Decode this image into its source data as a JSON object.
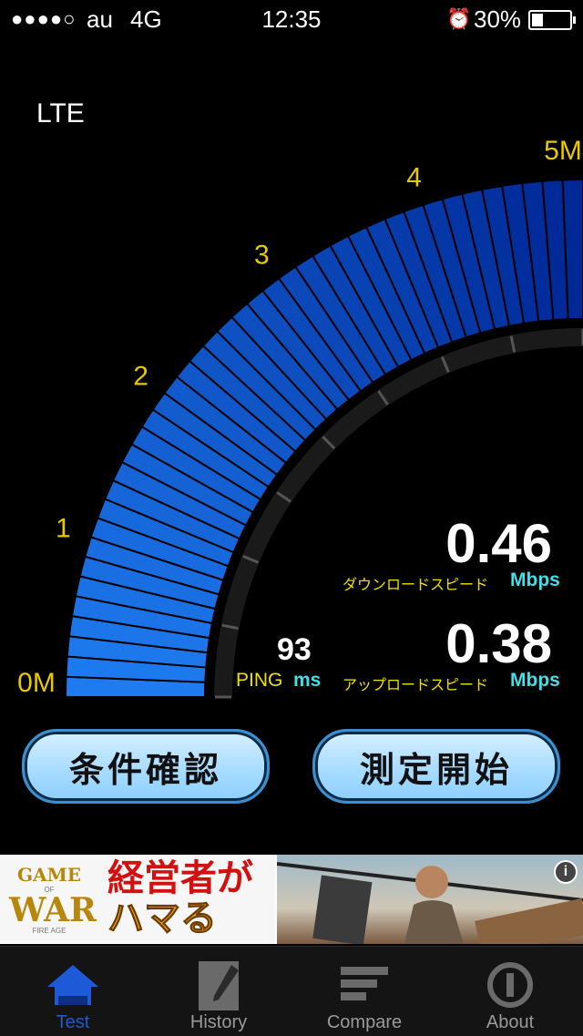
{
  "status_bar": {
    "signal": "●●●●○",
    "carrier": "au",
    "network": "4G",
    "time": "12:35",
    "alarm_icon": "alarm-clock-icon",
    "battery_percent": "30%",
    "battery_level": 0.3
  },
  "network_type": "LTE",
  "gauge": {
    "scale_labels": [
      "0M",
      "1",
      "2",
      "3",
      "4",
      "5M"
    ],
    "level_fraction": 0.09,
    "colors": {
      "bar_light": "#1e7cf0",
      "bar_dark": "#003a9a",
      "tick": "#e8c800"
    }
  },
  "download": {
    "value": "0.46",
    "label": "ダウンロードスピード",
    "unit": "Mbps"
  },
  "upload": {
    "value": "0.38",
    "label": "アップロードスピード",
    "unit": "Mbps"
  },
  "ping": {
    "value": "93",
    "label": "PING",
    "unit": "ms"
  },
  "buttons": {
    "conditions": "条件確認",
    "start": "測定開始"
  },
  "ad": {
    "logo_line1": "GAME",
    "logo_of": "OF",
    "logo_line2": "WAR",
    "logo_sub": "FIRE AGE",
    "copy_line1": "経営者が",
    "copy_line2": "ハマる",
    "info_icon": "info-icon"
  },
  "tabs": [
    {
      "label": "Test",
      "icon": "house-icon",
      "active": true
    },
    {
      "label": "History",
      "icon": "notepad-icon",
      "active": false
    },
    {
      "label": "Compare",
      "icon": "bars-icon",
      "active": false
    },
    {
      "label": "About",
      "icon": "info-circle-icon",
      "active": false
    }
  ]
}
